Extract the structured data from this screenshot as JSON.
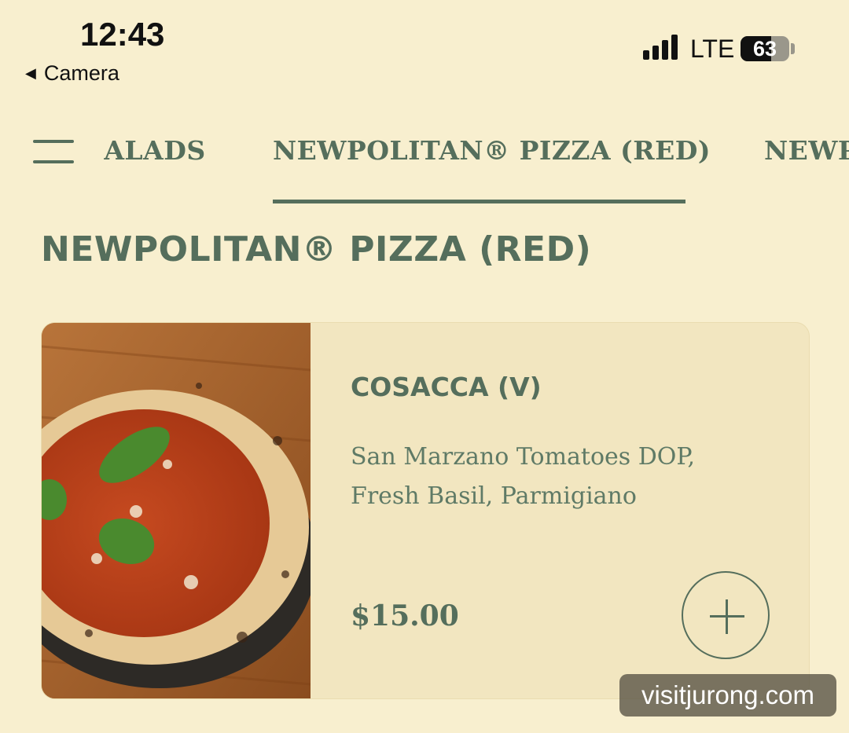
{
  "status_bar": {
    "time": "12:43",
    "back_label": "Camera",
    "network": "LTE",
    "battery_percent": "63",
    "battery_level": 0.63
  },
  "category_nav": {
    "tabs": [
      {
        "label": "SALADS",
        "visible_text": "ALADS"
      },
      {
        "label": "NEWPOLITAN® PIZZA (RED)",
        "active": true
      },
      {
        "label": "NEWP",
        "visible_text": "NEWP"
      }
    ]
  },
  "section": {
    "title": "NEWPOLITAN® PIZZA (RED)"
  },
  "product": {
    "name": "COSACCA (V)",
    "description": "San Marzano Tomatoes DOP, Fresh Basil, Parmigiano",
    "price": "$15.00",
    "image_icon": "pizza-photo",
    "add_icon": "plus-icon"
  },
  "watermark": "visitjurong.com",
  "colors": {
    "background": "#f8efcf",
    "card": "#f2e6c0",
    "accent": "#556e5c"
  }
}
